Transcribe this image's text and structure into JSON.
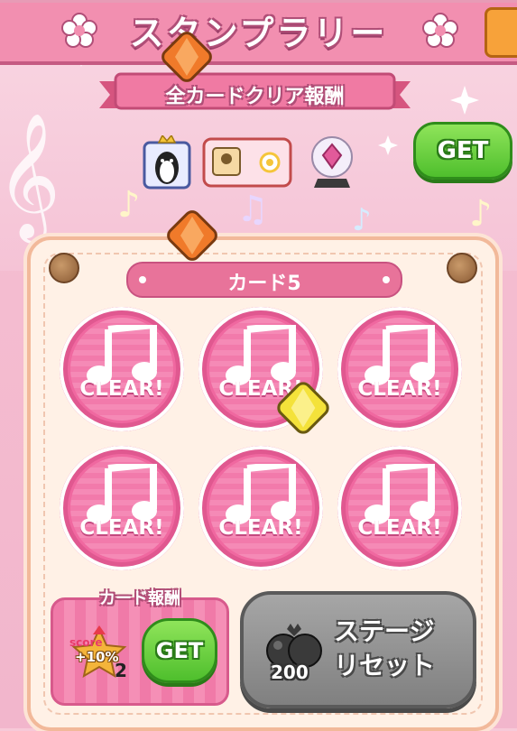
{
  "header": {
    "title": "スタンプラリー"
  },
  "ribbon": {
    "label": "全カードクリア報酬"
  },
  "all_clear_reward": {
    "get_label": "GET"
  },
  "card": {
    "title": "カード5"
  },
  "stamps": [
    {
      "label": "CLEAR!"
    },
    {
      "label": "CLEAR!"
    },
    {
      "label": "CLEAR!"
    },
    {
      "label": "CLEAR!"
    },
    {
      "label": "CLEAR!"
    },
    {
      "label": "CLEAR!"
    }
  ],
  "card_reward": {
    "label": "カード報酬",
    "score_word": "score",
    "bonus": "+10%",
    "count": "2",
    "get_label": "GET"
  },
  "stage_reset": {
    "label_line1": "ステージ",
    "label_line2": "リセット",
    "cost": "200"
  },
  "colors": {
    "header": "#f28fb0",
    "get_green": "#4fbf2d",
    "stamp_pink": "#f068a0",
    "reset_gray": "#808080"
  }
}
